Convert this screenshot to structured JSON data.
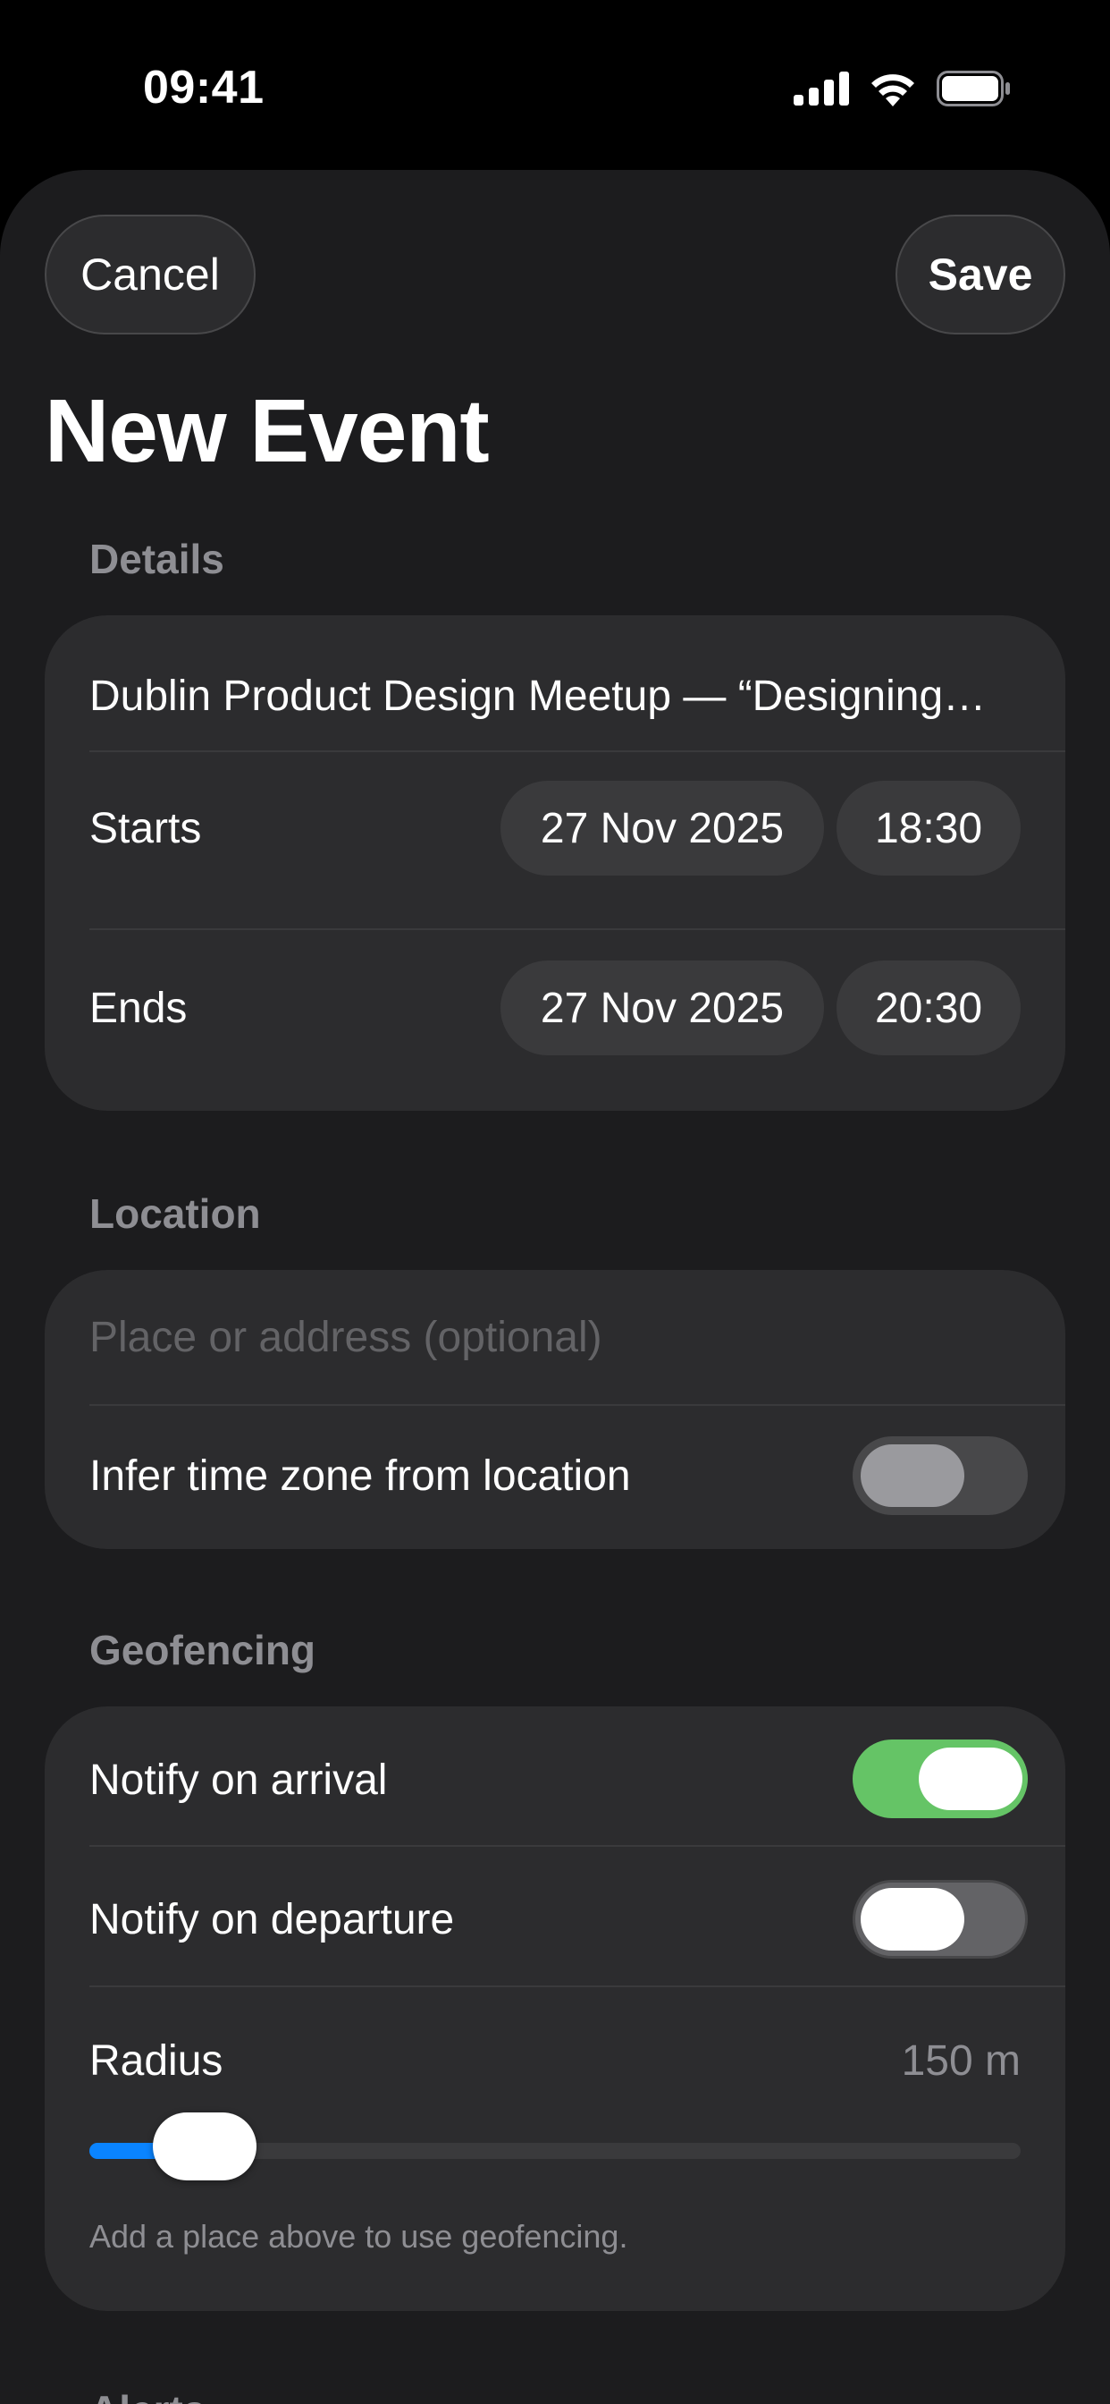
{
  "status_bar": {
    "time": "09:41",
    "icons": [
      "cellular-signal-icon",
      "wifi-icon",
      "battery-icon"
    ]
  },
  "nav": {
    "cancel_label": "Cancel",
    "save_label": "Save"
  },
  "title": "New Event",
  "details": {
    "header": "Details",
    "event_title": "Dublin Product Design Meetup — “Designing…",
    "starts": {
      "label": "Starts",
      "date": "27 Nov 2025",
      "time": "18:30"
    },
    "ends": {
      "label": "Ends",
      "date": "27 Nov 2025",
      "time": "20:30"
    }
  },
  "location": {
    "header": "Location",
    "placeholder": "Place or address (optional)",
    "value": "",
    "infer_timezone": {
      "label": "Infer time zone from location",
      "on": false
    }
  },
  "geofencing": {
    "header": "Geofencing",
    "notify_arrival": {
      "label": "Notify on arrival",
      "on": true
    },
    "notify_departure": {
      "label": "Notify on departure",
      "on": false
    },
    "radius": {
      "label": "Radius",
      "value_text": "150 m",
      "fraction": 0.03
    },
    "hint": "Add a place above to use geofencing."
  },
  "next_section_header": "Alerts",
  "colors": {
    "accent_green": "#65c466",
    "accent_blue": "#0a84ff",
    "card_background": "#2c2c2e",
    "sheet_background": "#1c1c1e"
  }
}
